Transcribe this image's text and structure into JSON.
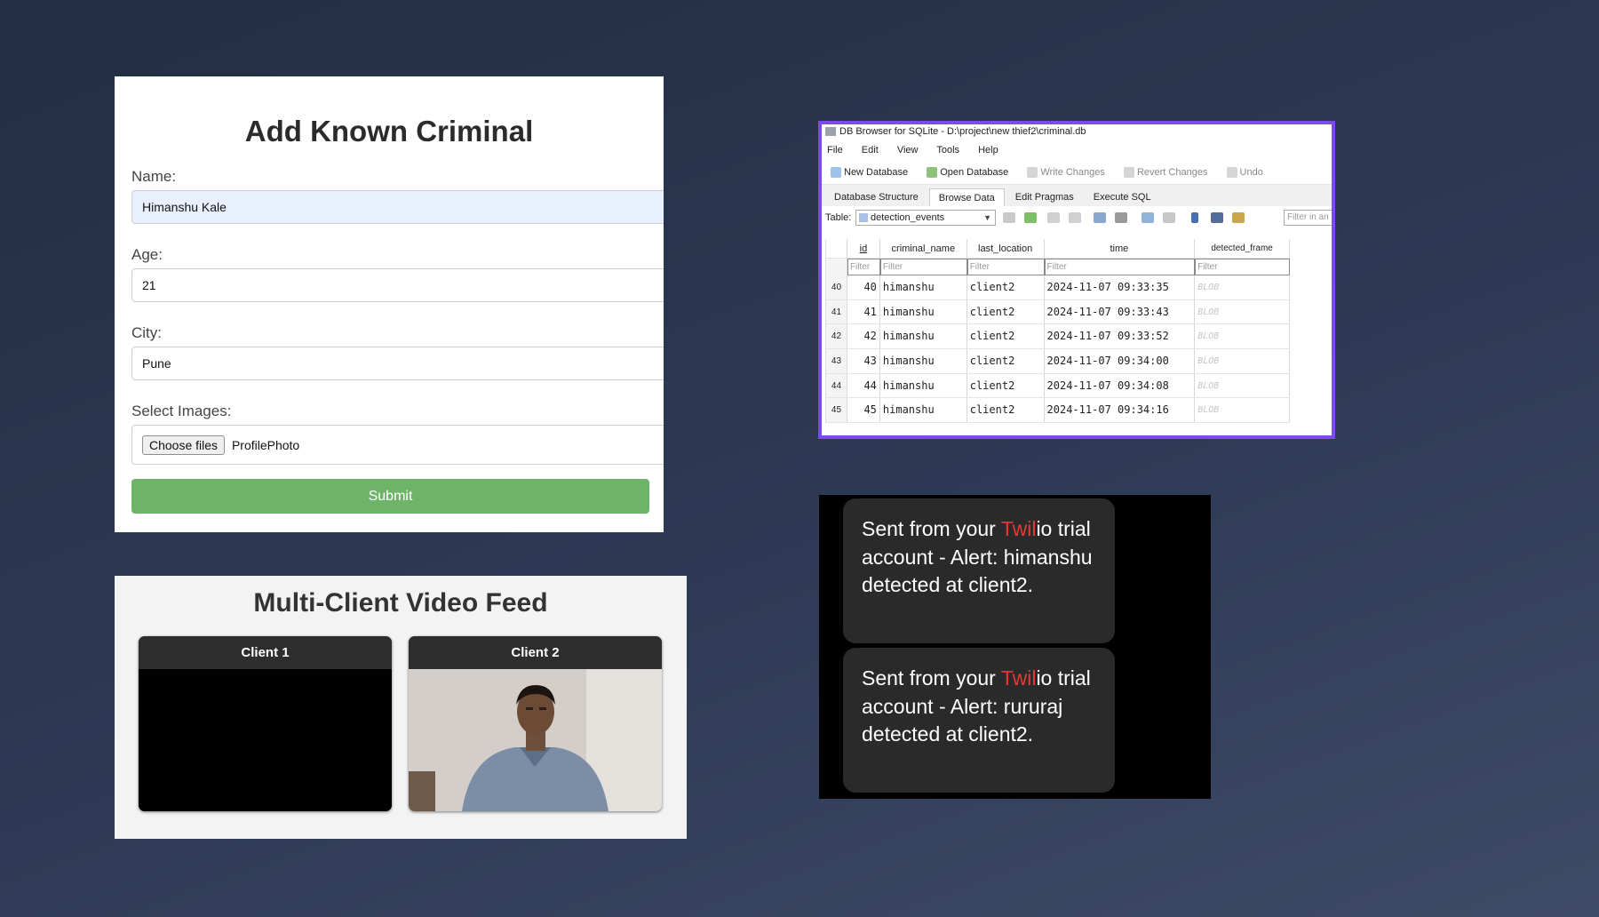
{
  "form": {
    "title": "Add Known Criminal",
    "name_label": "Name:",
    "name_value": "Himanshu Kale",
    "age_label": "Age:",
    "age_value": "21",
    "city_label": "City:",
    "city_value": "Pune",
    "images_label": "Select Images:",
    "choose_files_label": "Choose files",
    "file_name": "ProfilePhoto",
    "submit_label": "Submit"
  },
  "video": {
    "title": "Multi-Client Video Feed",
    "clients": [
      {
        "label": "Client 1"
      },
      {
        "label": "Client 2"
      }
    ]
  },
  "db": {
    "window_title": "DB Browser for SQLite - D:\\project\\new thief2\\criminal.db",
    "menu": [
      "File",
      "Edit",
      "View",
      "Tools",
      "Help"
    ],
    "toolbar": [
      "New Database",
      "Open Database",
      "Write Changes",
      "Revert Changes",
      "Undo"
    ],
    "tabs": [
      "Database Structure",
      "Browse Data",
      "Edit Pragmas",
      "Execute SQL"
    ],
    "table_label": "Table:",
    "table_selected": "detection_events",
    "filter_any_placeholder": "Filter in an",
    "columns": [
      "id",
      "criminal_name",
      "last_location",
      "time",
      "detected_frame"
    ],
    "filter_placeholder": "Filter",
    "rows": [
      {
        "rownum": "40",
        "id": "40",
        "criminal_name": "himanshu",
        "last_location": "client2",
        "time": "2024-11-07 09:33:35",
        "detected_frame": "BLOB"
      },
      {
        "rownum": "41",
        "id": "41",
        "criminal_name": "himanshu",
        "last_location": "client2",
        "time": "2024-11-07 09:33:43",
        "detected_frame": "BLOB"
      },
      {
        "rownum": "42",
        "id": "42",
        "criminal_name": "himanshu",
        "last_location": "client2",
        "time": "2024-11-07 09:33:52",
        "detected_frame": "BLOB"
      },
      {
        "rownum": "43",
        "id": "43",
        "criminal_name": "himanshu",
        "last_location": "client2",
        "time": "2024-11-07 09:34:00",
        "detected_frame": "BLOB"
      },
      {
        "rownum": "44",
        "id": "44",
        "criminal_name": "himanshu",
        "last_location": "client2",
        "time": "2024-11-07 09:34:08",
        "detected_frame": "BLOB"
      },
      {
        "rownum": "45",
        "id": "45",
        "criminal_name": "himanshu",
        "last_location": "client2",
        "time": "2024-11-07 09:34:16",
        "detected_frame": "BLOB"
      }
    ]
  },
  "sms": {
    "messages": [
      {
        "prefix": "Sent from your ",
        "brand_red": "Twil",
        "brand_rest": "io",
        "body": " trial account - Alert: himanshu detected at client2."
      },
      {
        "prefix": "Sent from your ",
        "brand_red": "Twil",
        "brand_rest": "io",
        "body": " trial account - Alert: rururaj detected at client2."
      }
    ],
    "accent_color": "#e53935"
  }
}
